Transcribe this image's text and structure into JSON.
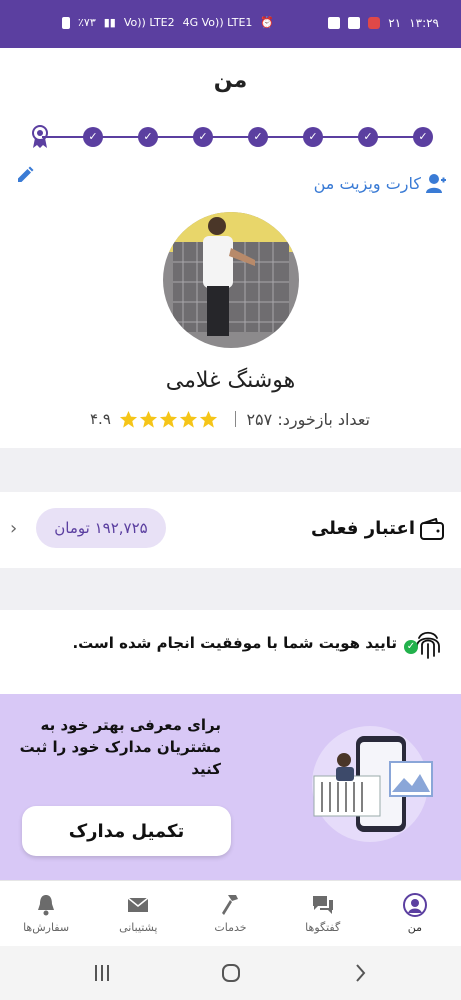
{
  "status_bar": {
    "time": "۱۳:۲۹",
    "battery": "٪۷۳",
    "sim1": "Vo)) LTE2",
    "sim2": "4G Vo)) LTE1",
    "badge": "۲۱"
  },
  "header": {
    "title": "من"
  },
  "progress": {
    "completed_steps": 8,
    "total_steps": 8
  },
  "profile": {
    "card_link": "کارت ویزیت من",
    "name": "هوشنگ غلامی",
    "feedback_count": "تعداد بازخورد: ۲۵۷",
    "rating": "۴.۹",
    "stars": 5
  },
  "credit": {
    "label": "اعتبار فعلی",
    "amount": "۱۹۲,۷۲۵ تومان"
  },
  "verification": {
    "text": "تایید هویت شما با موفقیت انجام شده است."
  },
  "promo": {
    "text": "برای معرفی بهتر خود به مشتریان مدارک خود را ثبت کنید",
    "button": "تکمیل مدارک"
  },
  "tabs": [
    {
      "label": "من",
      "icon": "profile-icon"
    },
    {
      "label": "گفتگوها",
      "icon": "chat-icon"
    },
    {
      "label": "خدمات",
      "icon": "hammer-icon"
    },
    {
      "label": "پشتیبانی",
      "icon": "mail-icon"
    },
    {
      "label": "سفارش‌ها",
      "icon": "bell-icon"
    }
  ],
  "colors": {
    "primary": "#5b3fa0",
    "link": "#3a7bd5",
    "promo_bg": "#d8c8f6",
    "star": "#f5c518",
    "success": "#22b14c"
  }
}
